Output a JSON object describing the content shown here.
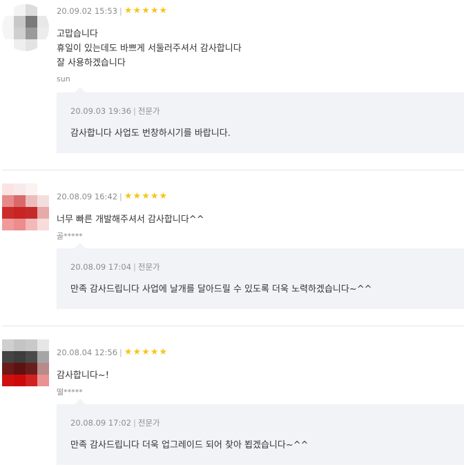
{
  "reviews": [
    {
      "date": "20.09.02 15:53",
      "rating": 5,
      "lines": [
        "고맙습니다",
        "휴일이 있는데도 바쁘게 서둘러주셔서 감사합니다",
        "잘 사용하겠습니다"
      ],
      "author": "sun",
      "reply": {
        "date": "20.09.03 19:36",
        "role": "전문가",
        "text": "감사합니다 사업도 번창하시기를 바랍니다."
      }
    },
    {
      "date": "20.08.09 16:42",
      "rating": 5,
      "lines": [
        "너무 빠른 개발해주셔서 감사합니다^^"
      ],
      "author": "골*****",
      "reply": {
        "date": "20.08.09 17:04",
        "role": "전문가",
        "text": "만족 감사드립니다 사업에 날개를 달아드릴 수 있도록 더욱 노력하겠습니다~^^"
      }
    },
    {
      "date": "20.08.04 12:56",
      "rating": 5,
      "lines": [
        "감사합니다~!"
      ],
      "author": "떨*****",
      "reply": {
        "date": "20.08.09 17:02",
        "role": "전문가",
        "text": "만족 감사드립니다 더욱 업그레이드 되어 찾아 뵙겠습니다~^^"
      }
    }
  ],
  "colors": {
    "star": "#f5c518",
    "reply_bg": "#f2f3f7",
    "divider": "#e6e6e6"
  },
  "icons": {
    "star": "star-icon"
  }
}
